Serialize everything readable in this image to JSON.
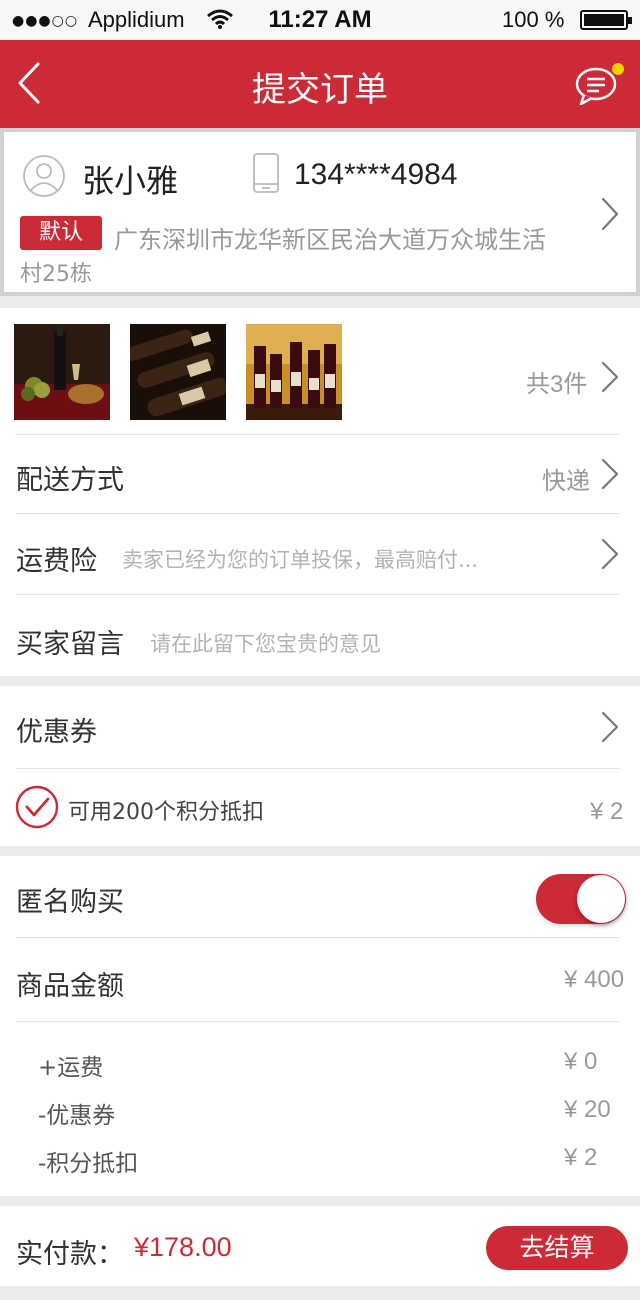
{
  "status_bar": {
    "signal": "●●●○○",
    "carrier": "Applidium",
    "time": "11:27 AM",
    "battery": "100 %"
  },
  "nav": {
    "title": "提交订单",
    "back_icon": "chevron-left-icon",
    "message_icon": "message-icon",
    "has_notification": true
  },
  "address": {
    "name": "张小雅",
    "phone": "134****4984",
    "badge": "默认",
    "line1": "广东深圳市龙华新区民治大道万众城生活",
    "line2": "村25栋"
  },
  "products": {
    "images": [
      "wine-still-life",
      "wine-bottles-rack",
      "wine-bottles-display"
    ],
    "count_label": "共3件"
  },
  "delivery": {
    "label": "配送方式",
    "value": "快递"
  },
  "insurance": {
    "label": "运费险",
    "hint": "卖家已经为您的订单投保，最高赔付..."
  },
  "buyer_message": {
    "label": "买家留言",
    "placeholder": "请在此留下您宝贵的意见"
  },
  "coupon": {
    "label": "优惠券"
  },
  "points": {
    "label": "可用200个积分抵扣",
    "value": "¥ 2",
    "checked": true
  },
  "anonymous": {
    "label": "匿名购买",
    "enabled": true
  },
  "goods_amount": {
    "label": "商品金额",
    "value": "¥ 400"
  },
  "breakdown": [
    {
      "label": "+运费",
      "value": "¥ 0"
    },
    {
      "label": "-优惠券",
      "value": "¥ 20"
    },
    {
      "label": "-积分抵扣",
      "value": "¥ 2"
    }
  ],
  "footer": {
    "label": "实付款：",
    "amount": "¥178.00",
    "button": "去结算"
  },
  "colors": {
    "accent": "#cc2a36",
    "page_bg": "#ececec"
  }
}
